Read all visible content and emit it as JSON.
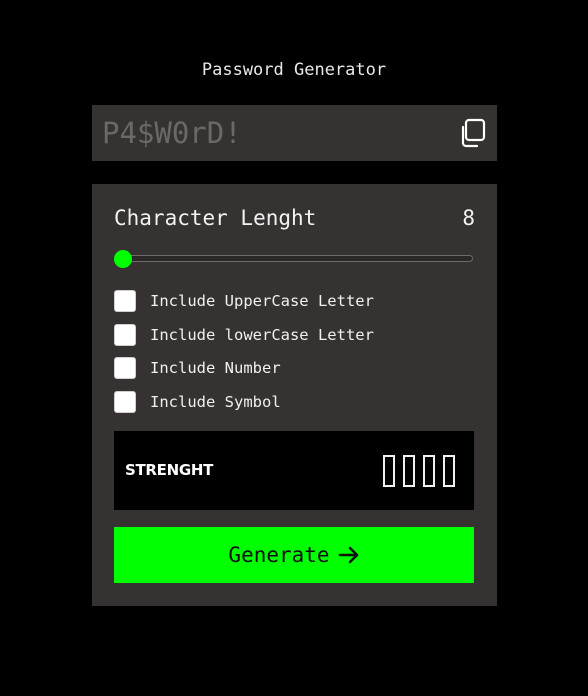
{
  "app": {
    "title": "Password Generator"
  },
  "password": {
    "placeholder": "P4$W0rD!",
    "value": "",
    "copy_icon": "copy-icon"
  },
  "settings": {
    "length_label": "Character Lenght",
    "length_value": "8",
    "slider": {
      "value": 8,
      "fill_fraction": 0.0
    },
    "options": [
      {
        "label": "Include UpperCase Letter",
        "checked": false
      },
      {
        "label": "Include lowerCase Letter",
        "checked": false
      },
      {
        "label": "Include Number",
        "checked": false
      },
      {
        "label": "Include Symbol",
        "checked": false
      }
    ]
  },
  "strength": {
    "label": "STRENGHT",
    "bars_total": 4,
    "bars_filled": 0
  },
  "generate": {
    "label": "Generate",
    "icon": "arrow-right-icon"
  },
  "colors": {
    "background": "#000000",
    "panel": "#353231",
    "accent": "#00ff00",
    "placeholder_text": "#6b6866"
  }
}
